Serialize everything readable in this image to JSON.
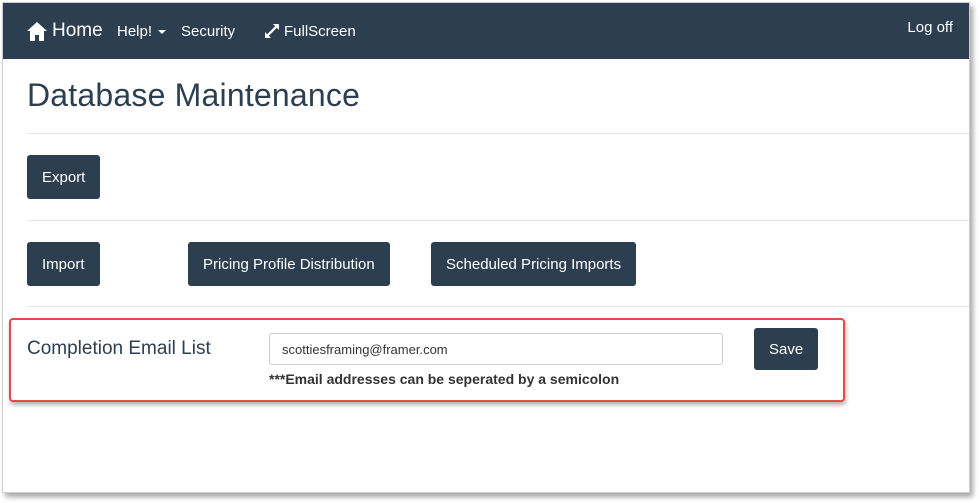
{
  "navbar": {
    "home_label": "Home",
    "help_label": "Help!",
    "security_label": "Security",
    "fullscreen_label": "FullScreen",
    "logoff_label": "Log off"
  },
  "page": {
    "title": "Database Maintenance"
  },
  "buttons": {
    "export": "Export",
    "import": "Import",
    "pricing_profile_distribution": "Pricing Profile Distribution",
    "scheduled_pricing_imports": "Scheduled Pricing Imports",
    "save": "Save"
  },
  "email_list": {
    "label": "Completion Email List",
    "value": "scottiesframing@framer.com",
    "hint": "***Email addresses can be seperated by a semicolon"
  },
  "colors": {
    "navbar_bg": "#2c3e50",
    "button_bg": "#2c3e50",
    "highlight_border": "#e8484a"
  },
  "icons": {
    "home": "home-icon",
    "fullscreen": "expand-arrows-icon",
    "help_dropdown": "caret-down-icon"
  }
}
